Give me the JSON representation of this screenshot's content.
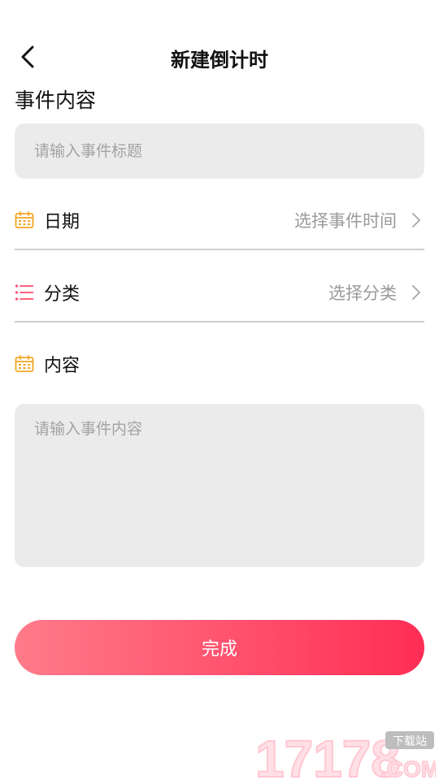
{
  "header": {
    "title": "新建倒计时",
    "back_icon": "chevron-left-icon"
  },
  "event": {
    "section_label": "事件内容",
    "title_placeholder": "请输入事件标题"
  },
  "rows": {
    "date": {
      "icon": "calendar-icon",
      "icon_color": "#f5a623",
      "label": "日期",
      "value": "选择事件时间"
    },
    "category": {
      "icon": "list-icon",
      "icon_color": "#ff4f6d",
      "label": "分类",
      "value": "选择分类"
    },
    "content": {
      "icon": "calendar-icon",
      "icon_color": "#f5a623",
      "label": "内容"
    }
  },
  "content": {
    "placeholder": "请输入事件内容"
  },
  "done_button": {
    "label": "完成",
    "gradient_start": "#ff7b8a",
    "gradient_end": "#ff2d55"
  },
  "watermark": {
    "number": "17178",
    "suffix": ".COM",
    "badge": "下载站"
  }
}
